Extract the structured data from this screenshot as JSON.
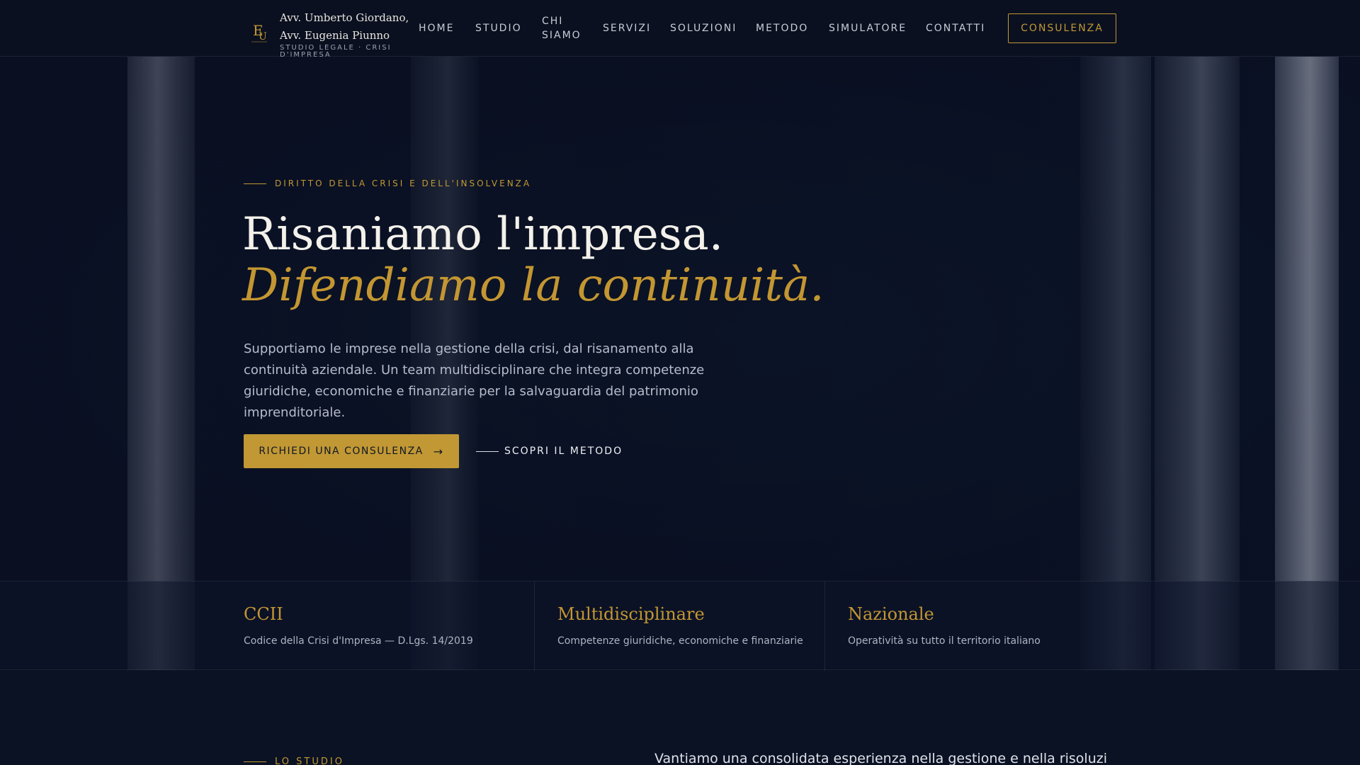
{
  "header": {
    "logo_line1": "Avv. Umberto Giordano,",
    "logo_line2": "Avv. Eugenia Piunno",
    "logo_tagline": "STUDIO LEGALE · CRISI D'IMPRESA",
    "nav": {
      "home": "HOME",
      "studio": "STUDIO",
      "chi_siamo": "CHI SIAMO",
      "servizi": "SERVIZI",
      "soluzioni": "SOLUZIONI",
      "metodo": "METODO",
      "simulatore": "SIMULATORE",
      "contatti": "CONTATTI"
    },
    "cta_label": "CONSULENZA"
  },
  "hero": {
    "eyebrow": "DIRITTO DELLA CRISI E DELL'INSOLVENZA",
    "title": "Risaniamo l'impresa.",
    "title_accent": "Difendiamo la continuità.",
    "description": "Supportiamo le imprese nella gestione della crisi, dal risanamento alla continuità aziendale. Un team multidisciplinare che integra competenze giuridiche, economiche e finanziarie per la salvaguardia del patrimonio imprenditoriale.",
    "primary_cta": "RICHIEDI UNA CONSULENZA",
    "secondary_cta": "SCOPRI IL METODO"
  },
  "stats": [
    {
      "title": "CCII",
      "desc": "Codice della Crisi d'Impresa — D.Lgs. 14/2019"
    },
    {
      "title": "Multidisciplinare",
      "desc": "Competenze giuridiche, economiche e finanziarie"
    },
    {
      "title": "Nazionale",
      "desc": "Operatività su tutto il territorio italiano"
    }
  ],
  "studio": {
    "eyebrow": "LO STUDIO",
    "text": "Vantiamo una consolidata esperienza nella gestione e nella risoluzione delle"
  },
  "colors": {
    "accent_gold": "#c19834",
    "background": "#0b1224"
  }
}
